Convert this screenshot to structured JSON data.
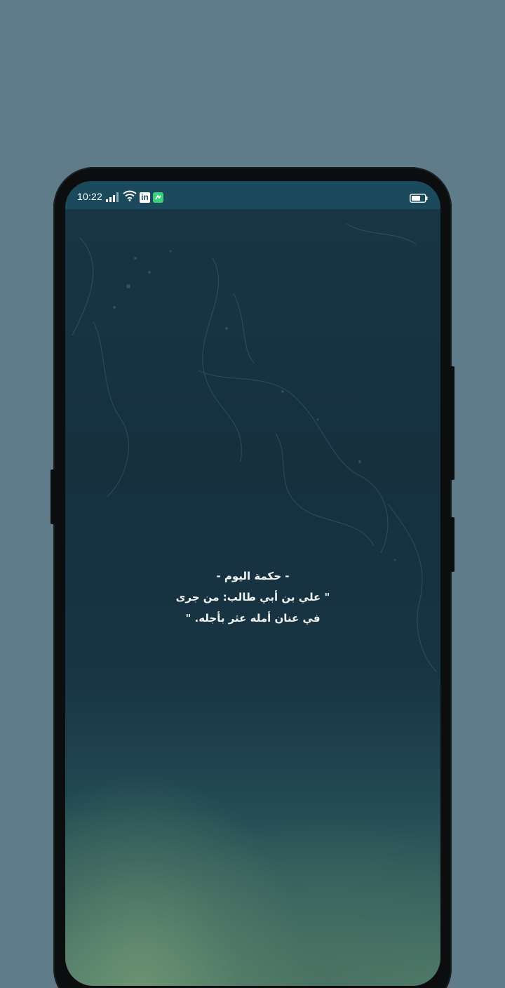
{
  "status_bar": {
    "time": "10:22",
    "icons": [
      "signal-icon",
      "wifi-icon",
      "linkedin-icon",
      "app-notification-icon",
      "battery-icon"
    ],
    "linkedin_text": "in",
    "background_color": "#1a4a5c"
  },
  "wisdom": {
    "title": "- حكمة اليوم -",
    "line1": "\" علي بن أبي طالب: من جرى",
    "line2": "في عنان أمله عثر بأجله. \""
  },
  "colors": {
    "page_background": "#607b8a",
    "screen_top": "#193646",
    "screen_bottom": "#53806c",
    "text": "#f2f4f2"
  }
}
